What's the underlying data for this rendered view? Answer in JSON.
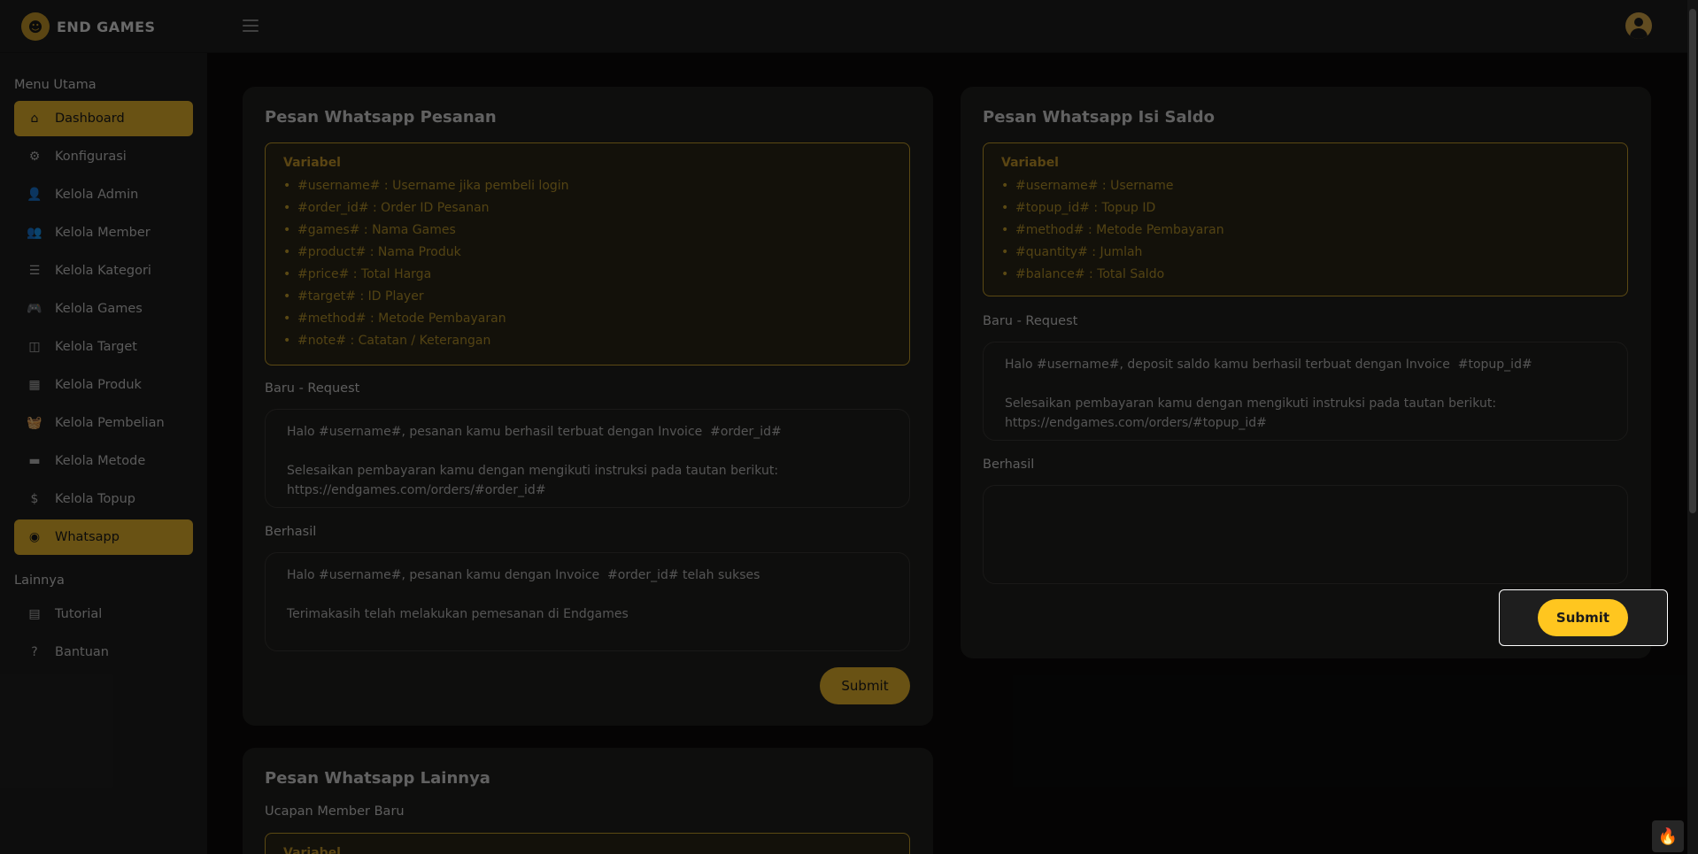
{
  "brand": {
    "name": "END GAMES"
  },
  "sidebar": {
    "section_main": "Menu Utama",
    "items": [
      {
        "label": "Dashboard",
        "icon": "⌂"
      },
      {
        "label": "Konfigurasi",
        "icon": "⚙"
      },
      {
        "label": "Kelola Admin",
        "icon": "👤"
      },
      {
        "label": "Kelola Member",
        "icon": "👥"
      },
      {
        "label": "Kelola Kategori",
        "icon": "☰"
      },
      {
        "label": "Kelola Games",
        "icon": "🎮"
      },
      {
        "label": "Kelola Target",
        "icon": "◫"
      },
      {
        "label": "Kelola Produk",
        "icon": "▦"
      },
      {
        "label": "Kelola Pembelian",
        "icon": "🧺"
      },
      {
        "label": "Kelola Metode",
        "icon": "▬"
      },
      {
        "label": "Kelola Topup",
        "icon": "$"
      },
      {
        "label": "Whatsapp",
        "icon": "◉"
      }
    ],
    "section_other": "Lainnya",
    "other_items": [
      {
        "label": "Tutorial",
        "icon": "▤"
      },
      {
        "label": "Bantuan",
        "icon": "?"
      }
    ]
  },
  "order_card": {
    "title": "Pesan Whatsapp Pesanan",
    "var_title": "Variabel",
    "vars": [
      "#username# : Username jika pembeli login",
      "#order_id# : Order ID Pesanan",
      "#games# : Nama Games",
      "#product# : Nama Produk",
      "#price# : Total Harga",
      "#target# : ID Player",
      "#method# : Metode Pembayaran",
      "#note# : Catatan / Keterangan"
    ],
    "request_label": "Baru - Request",
    "request_text": "Halo #username#, pesanan kamu berhasil terbuat dengan Invoice  #order_id#\n\nSelesaikan pembayaran kamu dengan mengikuti instruksi pada tautan berikut:\nhttps://endgames.com/orders/#order_id#",
    "success_label": "Berhasil",
    "success_text": "Halo #username#, pesanan kamu dengan Invoice  #order_id# telah sukses\n\nTerimakasih telah melakukan pemesanan di Endgames",
    "submit": "Submit"
  },
  "topup_card": {
    "title": "Pesan Whatsapp Isi Saldo",
    "var_title": "Variabel",
    "vars": [
      "#username# : Username",
      "#topup_id# : Topup ID",
      "#method# : Metode Pembayaran",
      "#quantity# : Jumlah",
      "#balance# : Total Saldo"
    ],
    "request_label": "Baru - Request",
    "request_text": "Halo #username#, deposit saldo kamu berhasil terbuat dengan Invoice  #topup_id#\n\nSelesaikan pembayaran kamu dengan mengikuti instruksi pada tautan berikut:\nhttps://endgames.com/orders/#topup_id#",
    "success_label": "Berhasil",
    "success_text": "",
    "submit": "Submit"
  },
  "other_card": {
    "title": "Pesan Whatsapp Lainnya",
    "new_member_label": "Ucapan Member Baru",
    "var_title": "Variabel"
  },
  "colors": {
    "accent": "#e9b52d",
    "card": "#201f1d",
    "sidebar": "#1e1e1e"
  }
}
